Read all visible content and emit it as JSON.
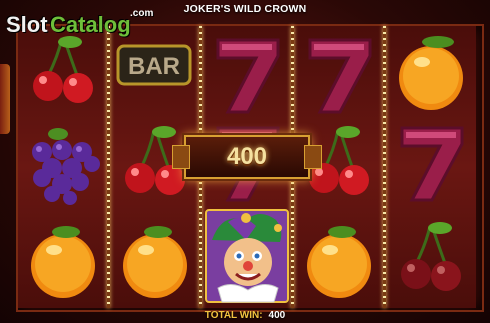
{
  "header": {
    "title": "JOKER'S WILD CROWN"
  },
  "logo": {
    "part1": "Slot",
    "part2": "Catalog",
    "suffix": ".com"
  },
  "win_plaque": {
    "amount": "400"
  },
  "footer": {
    "total_win_label": "TOTAL WIN:",
    "total_win_value": "400"
  },
  "reels": [
    [
      "cherry",
      "grapes",
      "orange"
    ],
    [
      "bar",
      "cherry",
      "orange"
    ],
    [
      "seven",
      "seven",
      "joker"
    ],
    [
      "seven",
      "cherry",
      "orange"
    ],
    [
      "orange",
      "seven",
      "cherry"
    ]
  ],
  "symbol_labels": {
    "bar": "BAR"
  },
  "colors": {
    "accent_gold": "#f2c340",
    "background": "#2a0806",
    "reel_separator": "#f7e7a8"
  }
}
